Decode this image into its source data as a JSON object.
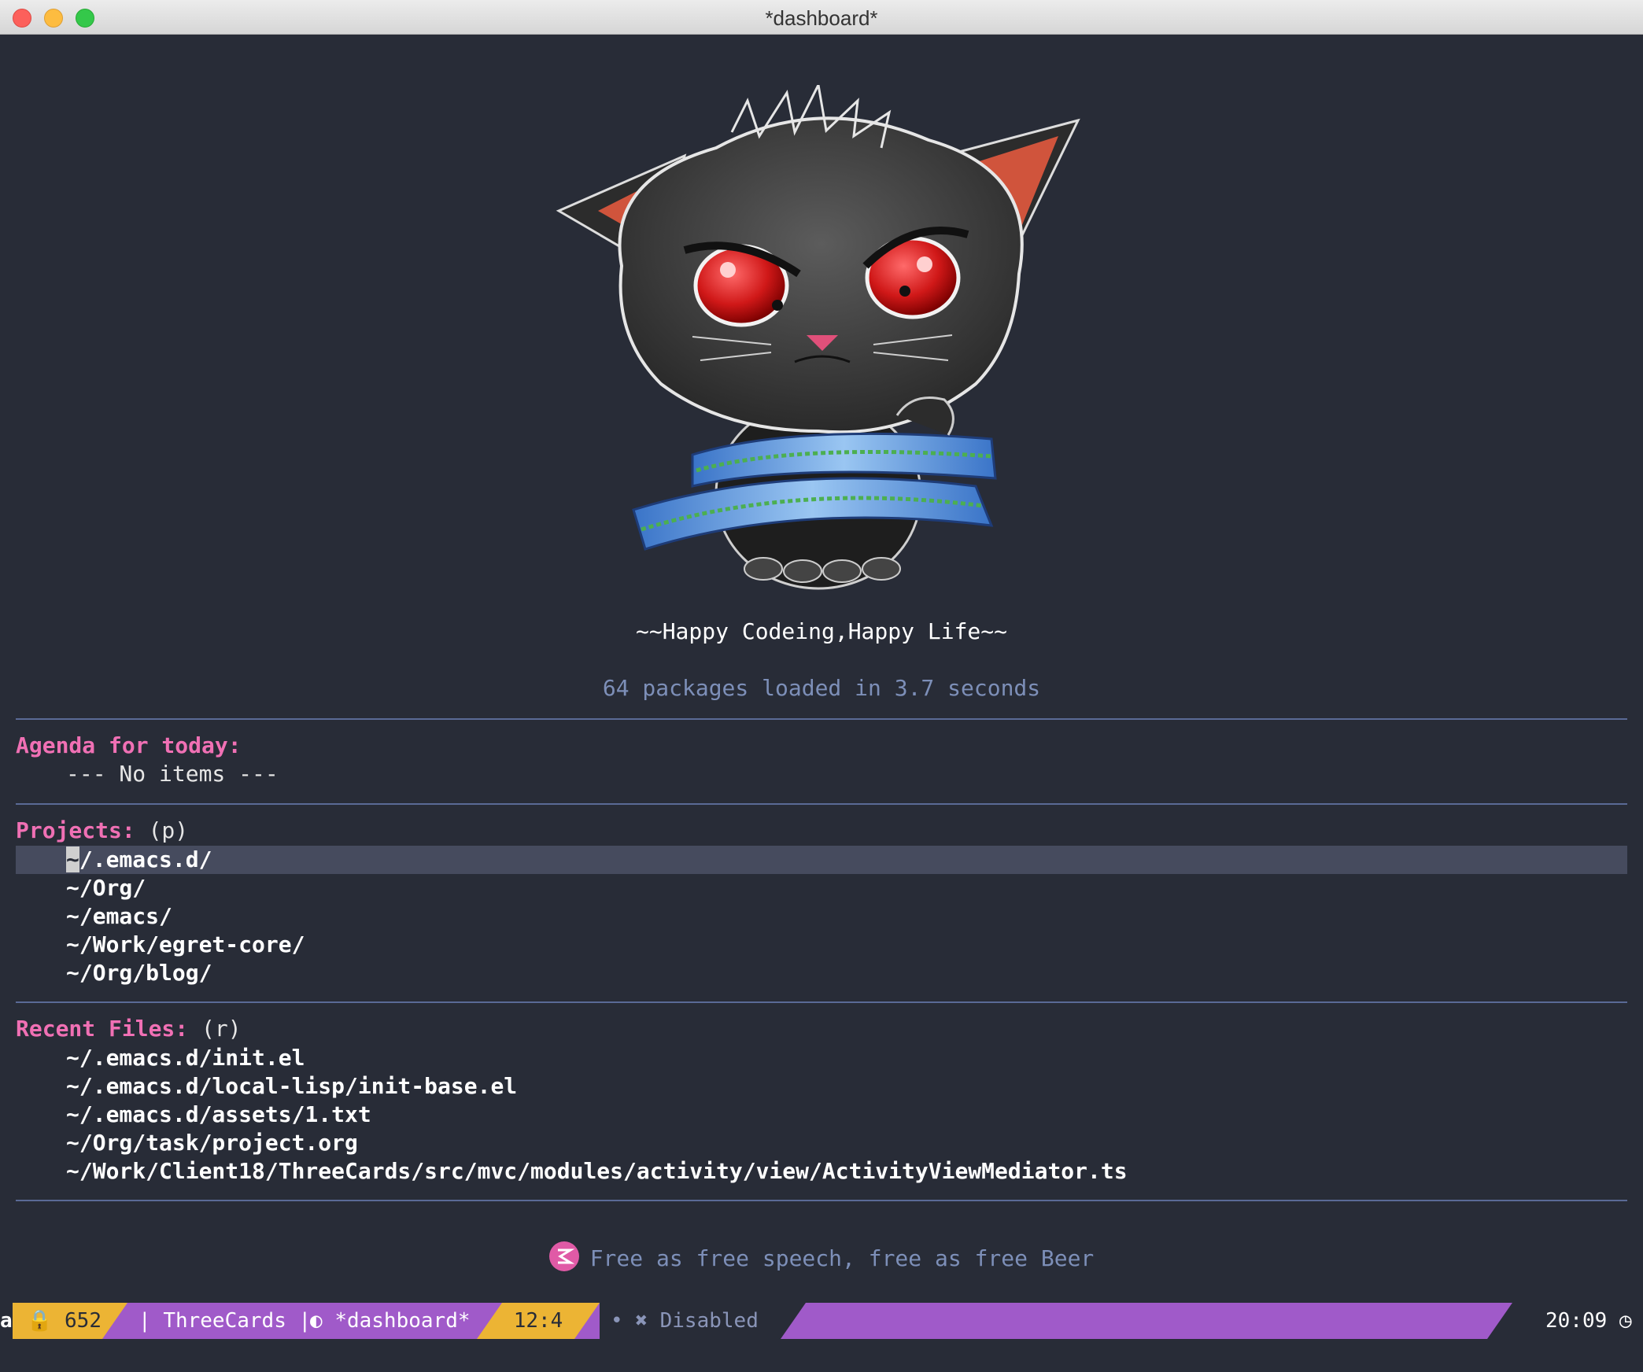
{
  "window": {
    "title": "*dashboard*"
  },
  "banner": {
    "slogan": "~~Happy Codeing,Happy Life~~",
    "loaded": "64 packages loaded in 3.7 seconds"
  },
  "agenda": {
    "heading": "Agenda for today:",
    "empty": "--- No items ---"
  },
  "projects": {
    "heading": "Projects:",
    "hint": " (p)",
    "cursor_char": "~",
    "first_rest": "/.emacs.d/",
    "items": [
      "~/Org/",
      "~/emacs/",
      "~/Work/egret-core/",
      "~/Org/blog/"
    ]
  },
  "recent": {
    "heading": "Recent Files:",
    "hint": " (r)",
    "items": [
      "~/.emacs.d/init.el",
      "~/.emacs.d/local-lisp/init-base.el",
      "~/.emacs.d/assets/1.txt",
      "~/Org/task/project.org",
      "~/Work/Client18/ThreeCards/src/mvc/modules/activity/view/ActivityViewMediator.ts"
    ]
  },
  "footer": {
    "text": "Free as free speech, free as free Beer"
  },
  "modeline": {
    "left_char": "a",
    "line_count": "652",
    "project": "ThreeCards",
    "buffer": "*dashboard*",
    "position": "12:4",
    "dot": "•",
    "flycheck": "Disabled",
    "time": "20:09"
  },
  "colors": {
    "background": "#282c37",
    "heading": "#f070b4",
    "comment": "#7d8fb8",
    "modeline": "#a05ac9",
    "modeline_accent": "#ecb434",
    "highlight_row": "#464b5e"
  }
}
